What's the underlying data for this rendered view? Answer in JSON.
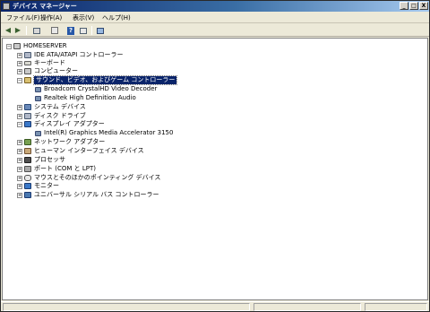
{
  "window": {
    "title": "デバイス マネージャー",
    "controls": {
      "minimize": "_",
      "maximize": "□",
      "close": "X"
    }
  },
  "menu": [
    "ファイル(F)",
    "操作(A)",
    "表示(V)",
    "ヘルプ(H)"
  ],
  "toolbar": [
    "back-arrow-icon",
    "forward-arrow-icon",
    "properties-icon",
    "update-icon",
    "help-icon",
    "view-icon",
    "scan-hardware-icon"
  ],
  "tree": {
    "root": "HOMESERVER",
    "items": [
      {
        "label": "IDE ATA/ATAPI コントローラー",
        "icon": "disk-controller-icon",
        "expanded": false
      },
      {
        "label": "キーボード",
        "icon": "keyboard-icon",
        "expanded": false
      },
      {
        "label": "コンピューター",
        "icon": "computer-icon",
        "expanded": false
      },
      {
        "label": "サウンド、ビデオ、およびゲーム コントローラー",
        "icon": "sound-icon",
        "expanded": true,
        "selected": true,
        "children": [
          "Broadcom CrystalHD Video Decoder",
          "Realtek High Definition Audio"
        ]
      },
      {
        "label": "システム デバイス",
        "icon": "system-icon",
        "expanded": false
      },
      {
        "label": "ディスク ドライブ",
        "icon": "disk-drive-icon",
        "expanded": false
      },
      {
        "label": "ディスプレイ アダプター",
        "icon": "display-adapter-icon",
        "expanded": true,
        "children": [
          "Intel(R) Graphics Media Accelerator 3150"
        ]
      },
      {
        "label": "ネットワーク アダプター",
        "icon": "network-icon",
        "expanded": false
      },
      {
        "label": "ヒューマン インターフェイス デバイス",
        "icon": "hid-icon",
        "expanded": false
      },
      {
        "label": "プロセッサ",
        "icon": "processor-icon",
        "expanded": false
      },
      {
        "label": "ポート (COM と LPT)",
        "icon": "port-icon",
        "expanded": false
      },
      {
        "label": "マウスとそのほかのポインティング デバイス",
        "icon": "mouse-icon",
        "expanded": false
      },
      {
        "label": "モニター",
        "icon": "monitor-icon",
        "expanded": false
      },
      {
        "label": "ユニバーサル シリアル バス コントローラー",
        "icon": "usb-icon",
        "expanded": false
      }
    ]
  }
}
